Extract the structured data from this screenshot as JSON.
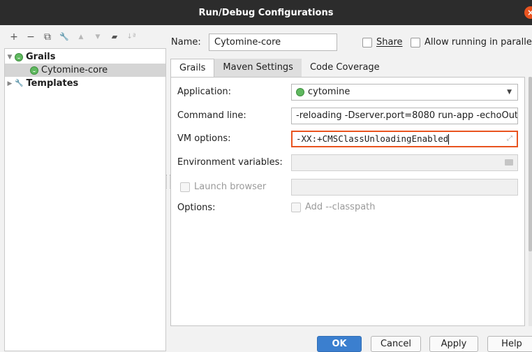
{
  "window": {
    "title": "Run/Debug Configurations",
    "close_glyph": "×"
  },
  "toolbar": {
    "icons": [
      "plus-icon",
      "minus-icon",
      "copy-icon",
      "wrench-icon",
      "arrow-up-icon",
      "arrow-down-icon",
      "folder-icon",
      "sort-icon"
    ],
    "glyphs": {
      "add": "+",
      "remove": "−",
      "copy": "⧉",
      "edit": "🔧",
      "up": "▲",
      "down": "▼",
      "folder": "▰",
      "sort": "↓ª"
    }
  },
  "tree": {
    "grails_label": "Grails",
    "config_label": "Cytomine-core",
    "templates_label": "Templates",
    "expanded_caret": "▼",
    "collapsed_caret": "▶",
    "wrench_glyph": "🔧"
  },
  "header": {
    "name_label": "Name:",
    "name_value": "Cytomine-core",
    "share_label": "Share",
    "allow_label": "Allow running in paralle"
  },
  "tabs": [
    {
      "label": "Grails"
    },
    {
      "label": "Maven Settings"
    },
    {
      "label": "Code Coverage"
    }
  ],
  "form": {
    "application_label": "Application:",
    "application_value": "cytomine",
    "command_label": "Command line:",
    "command_value": "-reloading -Dserver.port=8080 run-app -echoOut",
    "vm_label": "VM options:",
    "vm_value": "-XX:+CMSClassUnloadingEnabled",
    "env_label": "Environment variables:",
    "launch_label": "Launch browser",
    "options_label": "Options:",
    "classpath_label": "Add --classpath",
    "dropdown_glyph": "▼",
    "expand_glyph": "⤢"
  },
  "buttons": {
    "ok": "OK",
    "cancel": "Cancel",
    "apply": "Apply",
    "help": "Help"
  },
  "colors": {
    "accent": "#e95420",
    "primary_button": "#3b7fcf",
    "titlebar": "#2c2c2c",
    "grails_green": "#5fb85f"
  }
}
